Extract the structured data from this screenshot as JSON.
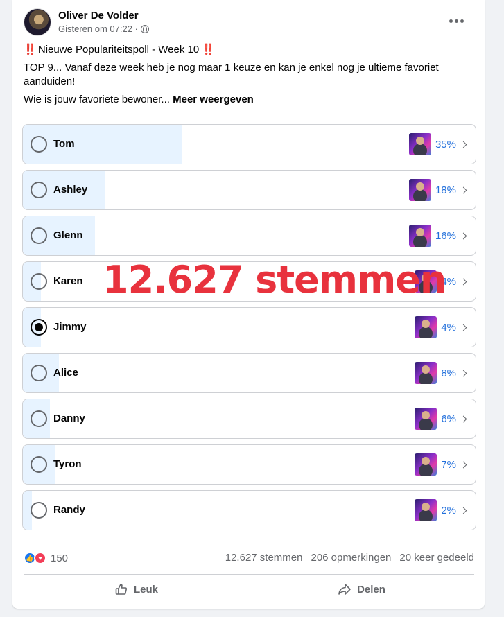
{
  "post": {
    "author": "Oliver De Volder",
    "timestamp": "Gisteren om 07:22 ·",
    "title_text": "Nieuwe Populariteitspoll - Week 10",
    "title_marks": "‼️",
    "body": "TOP 9... Vanaf deze week heb je nog maar 1 keuze en kan je enkel nog je ultieme favoriet aanduiden!",
    "question": "Wie is  jouw favoriete bewoner...",
    "see_more": "Meer weergeven"
  },
  "poll": {
    "options": [
      {
        "label": "Tom",
        "percent": "35%",
        "fill": 0.35,
        "selected": false
      },
      {
        "label": "Ashley",
        "percent": "18%",
        "fill": 0.18,
        "selected": false
      },
      {
        "label": "Glenn",
        "percent": "16%",
        "fill": 0.16,
        "selected": false
      },
      {
        "label": "Karen",
        "percent": "4%",
        "fill": 0.04,
        "selected": false
      },
      {
        "label": "Jimmy",
        "percent": "4%",
        "fill": 0.04,
        "selected": true
      },
      {
        "label": "Alice",
        "percent": "8%",
        "fill": 0.08,
        "selected": false
      },
      {
        "label": "Danny",
        "percent": "6%",
        "fill": 0.06,
        "selected": false
      },
      {
        "label": "Tyron",
        "percent": "7%",
        "fill": 0.07,
        "selected": false
      },
      {
        "label": "Randy",
        "percent": "2%",
        "fill": 0.02,
        "selected": false
      }
    ]
  },
  "overlay_text": "12.627 stemmen",
  "stats": {
    "reactions": "150",
    "votes": "12.627 stemmen",
    "comments": "206 opmerkingen",
    "shares": "20 keer gedeeld"
  },
  "actions": {
    "like": "Leuk",
    "share": "Delen"
  },
  "colors": {
    "accent": "#216fdb",
    "fill": "#e7f3ff",
    "overlay": "#e8323d"
  }
}
